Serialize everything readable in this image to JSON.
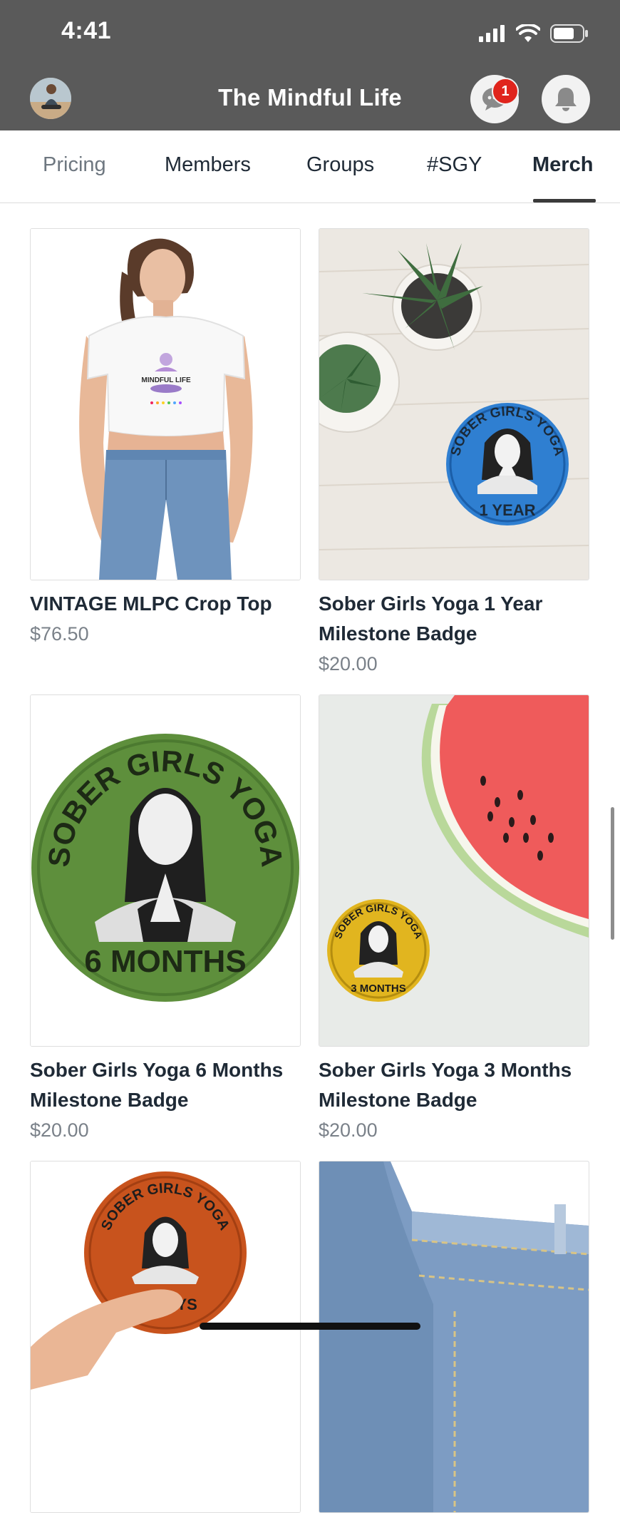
{
  "status": {
    "time": "4:41"
  },
  "header": {
    "title": "The Mindful Life",
    "chat_badge": "1"
  },
  "tabs": [
    {
      "label": "Pricing"
    },
    {
      "label": "Members"
    },
    {
      "label": "Groups"
    },
    {
      "label": "#SGY"
    },
    {
      "label": "Merch"
    }
  ],
  "active_tab": "Merch",
  "products": [
    {
      "title": "VINTAGE MLPC Crop Top",
      "price": "$76.50",
      "image_text": [
        "MINDFUL LIFE"
      ]
    },
    {
      "title": "Sober Girls Yoga 1 Year Milestone Badge",
      "price": "$20.00",
      "image_text": [
        "SOBER GIRLS YOGA",
        "1 YEAR"
      ]
    },
    {
      "title": "Sober Girls Yoga 6 Months Milestone Badge",
      "price": "$20.00",
      "image_text": [
        "SOBER GIRLS YOGA",
        "6 MONTHS"
      ]
    },
    {
      "title": "Sober Girls Yoga 3 Months Milestone Badge",
      "price": "$20.00",
      "image_text": [
        "SOBER GIRLS YOGA",
        "3 MONTHS"
      ]
    },
    {
      "title": "",
      "price": "",
      "image_text": [
        "SOBER GIRLS YOGA",
        "60 DAYS"
      ]
    },
    {
      "title": "",
      "price": "",
      "image_text": []
    }
  ],
  "colors": {
    "header_bg": "#5a5a5a",
    "badge_red": "#e0241c",
    "badge_blue": "#2f7fd1",
    "badge_green": "#5e8f3c",
    "badge_yellow": "#e1b51f",
    "badge_orange": "#c8531d"
  }
}
